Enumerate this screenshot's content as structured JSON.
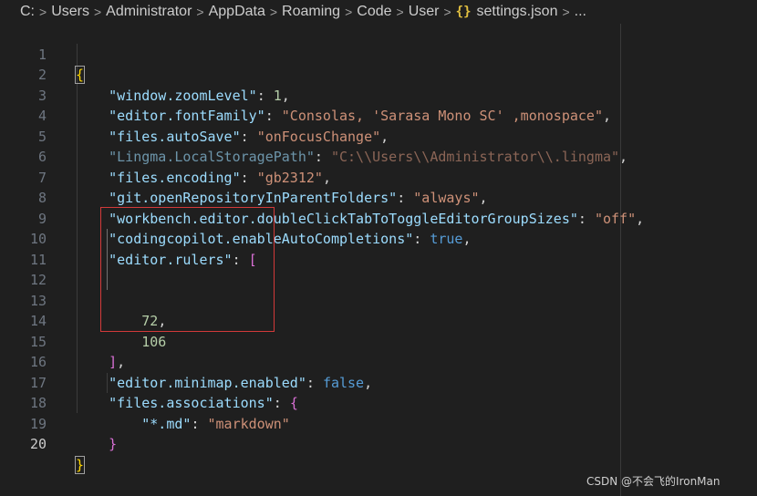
{
  "breadcrumb": {
    "items": [
      "C:",
      "Users",
      "Administrator",
      "AppData",
      "Roaming",
      "Code",
      "User"
    ],
    "separator": ">",
    "file_icon": "{}",
    "file": "settings.json",
    "more": "..."
  },
  "editor": {
    "active_line": 20,
    "lines": [
      {
        "n": "1"
      },
      {
        "n": "2"
      },
      {
        "n": "3"
      },
      {
        "n": "4"
      },
      {
        "n": "5"
      },
      {
        "n": "6"
      },
      {
        "n": "7"
      },
      {
        "n": "8"
      },
      {
        "n": "9"
      },
      {
        "n": "10"
      },
      {
        "n": "11"
      },
      {
        "n": "12"
      },
      {
        "n": "13"
      },
      {
        "n": "14"
      },
      {
        "n": "15"
      },
      {
        "n": "16"
      },
      {
        "n": "17"
      },
      {
        "n": "18"
      },
      {
        "n": "19"
      },
      {
        "n": "20"
      }
    ],
    "tokens": {
      "open_brace": "{",
      "close_brace": "}",
      "l2_key": "\"window.zoomLevel\"",
      "l2_val": "1",
      "l3_key": "\"editor.fontFamily\"",
      "l3_val": "\"Consolas, 'Sarasa Mono SC' ,monospace\"",
      "l4_key": "\"files.autoSave\"",
      "l4_val": "\"onFocusChange\"",
      "l5_key": "\"Lingma.LocalStoragePath\"",
      "l5_val": "\"C:\\\\Users\\\\Administrator\\\\.lingma\"",
      "l6_key": "\"files.encoding\"",
      "l6_val": "\"gb2312\"",
      "l7_key": "\"git.openRepositoryInParentFolders\"",
      "l7_val": "\"always\"",
      "l8_key": "\"workbench.editor.doubleClickTabToToggleEditorGroupSizes\"",
      "l8_val": "\"off\"",
      "l9_key": "\"codingcopilot.enableAutoCompletions\"",
      "l9_val": "true",
      "l10_key": "\"editor.rulers\"",
      "l10_open": "[",
      "l13_val": "72",
      "l14_val": "106",
      "l15_close": "]",
      "l16_key": "\"editor.minimap.enabled\"",
      "l16_val": "false",
      "l17_key": "\"files.associations\"",
      "l17_open": "{",
      "l18_key": "\"*.md\"",
      "l18_val": "\"markdown\"",
      "l19_close": "}"
    }
  },
  "watermark": "CSDN @不会飞的IronMan",
  "colors": {
    "background": "#1f1f1f",
    "key": "#9cdcfe",
    "string": "#ce9178",
    "number": "#b5cea8",
    "boolean": "#569cd6",
    "bracket_level1": "#ffd700",
    "bracket_level2": "#da70d6",
    "bracket_level3": "#179fff",
    "highlight_box": "#d33a3a"
  }
}
